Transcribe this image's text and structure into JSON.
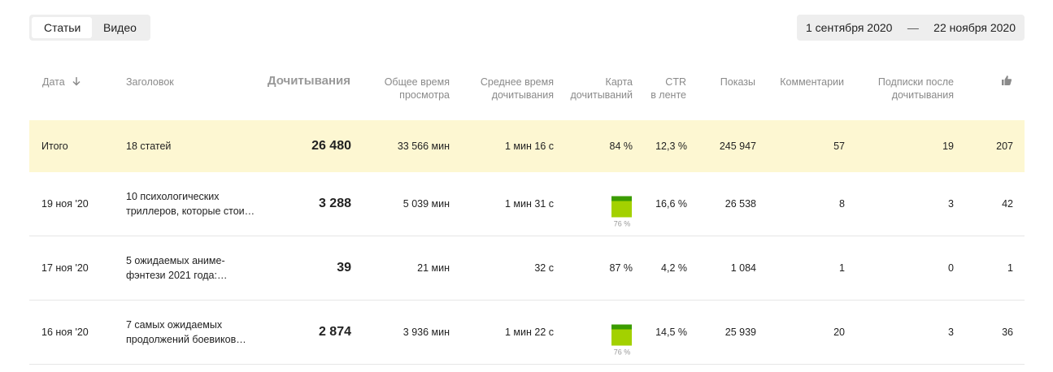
{
  "tabs": [
    {
      "label": "Статьи",
      "active": true
    },
    {
      "label": "Видео",
      "active": false
    }
  ],
  "date_range": {
    "from": "1 сентября 2020",
    "separator": "—",
    "to": "22 ноября 2020"
  },
  "headers": {
    "date": "Дата",
    "title": "Заголовок",
    "reads": "Дочитывания",
    "total_time_1": "Общее время",
    "total_time_2": "просмотра",
    "avg_time_1": "Среднее время",
    "avg_time_2": "дочитывания",
    "map_1": "Карта",
    "map_2": "дочитываний",
    "ctr_1": "CTR",
    "ctr_2": "в ленте",
    "views": "Показы",
    "comments": "Комментарии",
    "subs_1": "Подписки после",
    "subs_2": "дочитывания",
    "likes_icon": "thumbs-up-icon"
  },
  "total": {
    "label": "Итого",
    "title": "18 статей",
    "reads": "26 480",
    "total_time": "33 566 мин",
    "avg_time": "1 мин 16 с",
    "map": "84 %",
    "ctr": "12,3 %",
    "views": "245 947",
    "comments": "57",
    "subs": "19",
    "likes": "207"
  },
  "rows": [
    {
      "date": "19 ноя '20",
      "title": "10 психологических триллеров, которые стои…",
      "reads": "3 288",
      "total_time": "5 039 мин",
      "avg_time": "1 мин 31 с",
      "map_bar": true,
      "map_fraction": 0.76,
      "map": "76 %",
      "ctr": "16,6 %",
      "views": "26 538",
      "comments": "8",
      "subs": "3",
      "likes": "42"
    },
    {
      "date": "17 ноя '20",
      "title": "5 ожидаемых аниме-фэнтези 2021 года:…",
      "reads": "39",
      "total_time": "21 мин",
      "avg_time": "32 с",
      "map_bar": false,
      "map": "87 %",
      "ctr": "4,2 %",
      "views": "1 084",
      "comments": "1",
      "subs": "0",
      "likes": "1"
    },
    {
      "date": "16 ноя '20",
      "title": "7 самых ожидаемых продолжений боевиков…",
      "reads": "2 874",
      "total_time": "3 936 мин",
      "avg_time": "1 мин 22 с",
      "map_bar": true,
      "map_fraction": 0.76,
      "map": "76 %",
      "ctr": "14,5 %",
      "views": "25 939",
      "comments": "20",
      "subs": "3",
      "likes": "36"
    }
  ],
  "colors": {
    "total_bg": "#fdf7d2",
    "bar_green": "#a3d100",
    "bar_dark": "#3b9c00"
  }
}
